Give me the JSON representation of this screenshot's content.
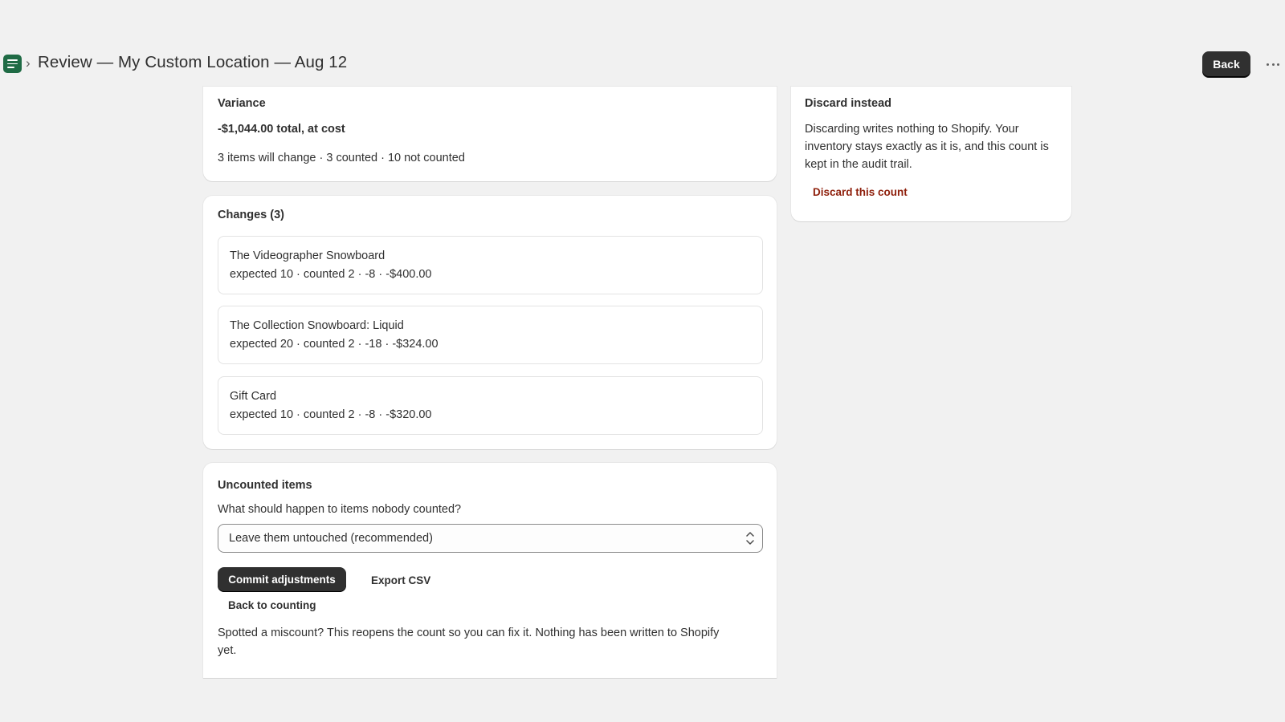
{
  "header": {
    "title": "Review — My Custom Location — Aug 12",
    "back_label": "Back",
    "app_icon": "order-list-icon",
    "breadcrumb_icon": "chevron-right-icon",
    "more_icon": "more-horizontal-icon"
  },
  "variance": {
    "heading": "Variance",
    "total": "-$1,044.00 total, at cost",
    "summary": "3 items will change · 3 counted · 10 not counted"
  },
  "discard": {
    "heading": "Discard instead",
    "body": "Discarding writes nothing to Shopify. Your inventory stays exactly as it is, and this count is kept in the audit trail.",
    "link_label": "Discard this count",
    "link_color": "#8e1f0b"
  },
  "changes": {
    "heading": "Changes (3)",
    "items": [
      {
        "name": "The Videographer Snowboard",
        "detail": "expected 10 · counted 2 · -8 · -$400.00"
      },
      {
        "name": "The Collection Snowboard: Liquid",
        "detail": "expected 20 · counted 2 · -18 · -$324.00"
      },
      {
        "name": "Gift Card",
        "detail": "expected 10 · counted 2 · -8 · -$320.00"
      }
    ]
  },
  "uncounted": {
    "heading": "Uncounted items",
    "question": "What should happen to items nobody counted?",
    "selected_option": "Leave them untouched (recommended)",
    "commit_label": "Commit adjustments",
    "export_label": "Export CSV",
    "back_counting_label": "Back to counting",
    "note": "Spotted a miscount? This reopens the count so you can fix it. Nothing has been written to Shopify yet."
  },
  "colors": {
    "background": "#f1f1f1",
    "primary_button": "#303030",
    "app_icon": "#1f6b45"
  }
}
